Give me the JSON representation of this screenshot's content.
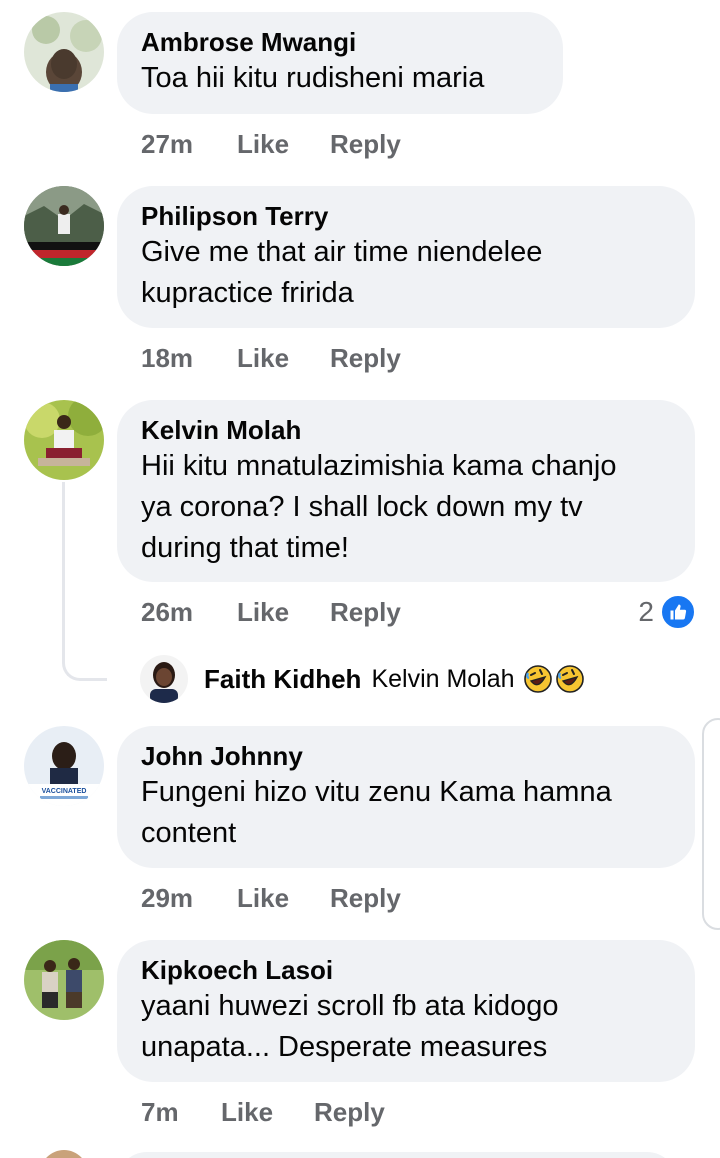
{
  "comments": [
    {
      "author": "Ambrose Mwangi",
      "text": "Toa hii kitu rudisheni maria",
      "time": "27m",
      "like_label": "Like",
      "reply_label": "Reply"
    },
    {
      "author": "Philipson Terry",
      "text_lines": [
        "Give me that air time niendelee",
        "kupractice fririda"
      ],
      "time": "18m",
      "like_label": "Like",
      "reply_label": "Reply"
    },
    {
      "author": "Kelvin Molah",
      "text_lines": [
        "Hii kitu mnatulazimishia kama chanjo",
        "ya corona?  I shall lock down my tv",
        "during that time!"
      ],
      "time": "26m",
      "like_label": "Like",
      "reply_label": "Reply",
      "reaction_count": "2",
      "reaction_icon": "thumbs-up-icon",
      "reply_preview": {
        "author": "Faith Kidheh",
        "text": "Kelvin Molah",
        "emojis": [
          "rolling-on-floor-laughing-icon",
          "rolling-on-floor-laughing-icon"
        ]
      }
    },
    {
      "author": "John Johnny",
      "avatar_badge": "VACCINATED",
      "text_lines": [
        "Fungeni hizo vitu zenu Kama hamna",
        "content"
      ],
      "time": "29m",
      "like_label": "Like",
      "reply_label": "Reply"
    },
    {
      "author": "Kipkoech Lasoi",
      "text_lines": [
        "yaani huwezi scroll fb ata kidogo",
        "unapata... Desperate measures"
      ],
      "time": "7m",
      "like_label": "Like",
      "reply_label": "Reply"
    }
  ],
  "colors": {
    "bubble": "#f0f2f5",
    "meta": "#65676b",
    "like_blue": "#1877f2",
    "text": "#050505"
  }
}
